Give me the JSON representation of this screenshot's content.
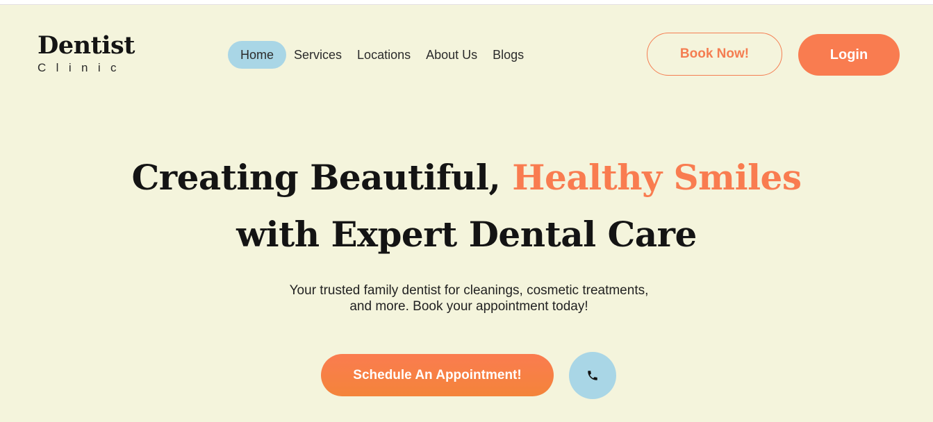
{
  "logo": {
    "title": "Dentist",
    "subtitle": "Clinic"
  },
  "nav": {
    "items": [
      {
        "label": "Home",
        "active": true
      },
      {
        "label": "Services",
        "active": false
      },
      {
        "label": "Locations",
        "active": false
      },
      {
        "label": "About Us",
        "active": false
      },
      {
        "label": "Blogs",
        "active": false
      }
    ]
  },
  "header": {
    "book_label": "Book Now!",
    "login_label": "Login"
  },
  "hero": {
    "title_part1": "Creating Beautiful, ",
    "title_accent": "Healthy Smiles",
    "title_part2": " with Expert Dental Care",
    "subtitle_line1": "Your trusted family dentist for cleanings, cosmetic treatments,",
    "subtitle_line2": "and more. Book your appointment today!",
    "cta_label": "Schedule An Appointment!",
    "phone_icon": "phone-icon"
  },
  "colors": {
    "background": "#f4f4dc",
    "accent": "#f97c50",
    "light_blue": "#a9d6e6",
    "text": "#141414"
  }
}
